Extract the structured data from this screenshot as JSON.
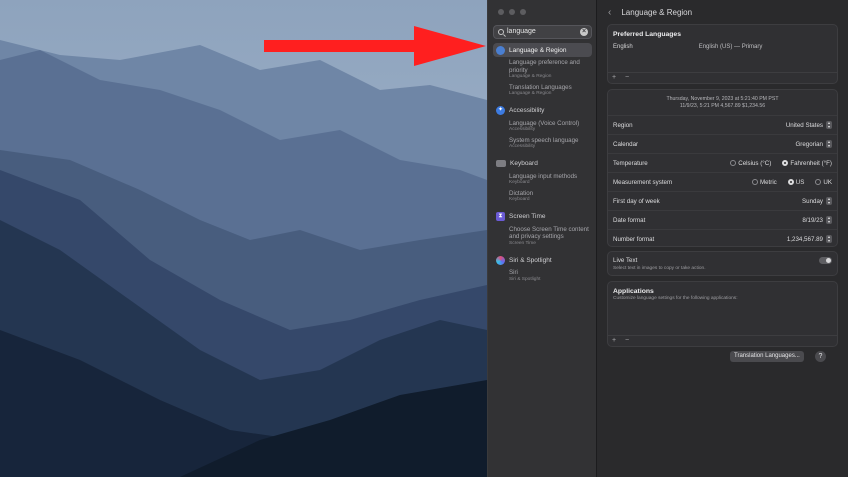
{
  "colors": {
    "accent": "#4a7fd1",
    "annotation_arrow": "#ff1f1f"
  },
  "search": {
    "value": "language"
  },
  "sidebar": {
    "groups": [
      {
        "label": "Language & Region",
        "icon": "globe-icon",
        "selected": true,
        "items": [
          {
            "title": "Language preference and priority",
            "subtitle": "Language & Region"
          },
          {
            "title": "Translation Languages",
            "subtitle": "Language & Region"
          }
        ]
      },
      {
        "label": "Accessibility",
        "icon": "accessibility-icon",
        "items": [
          {
            "title": "Language (Voice Control)",
            "subtitle": "Accessibility"
          },
          {
            "title": "System speech language",
            "subtitle": "Accessibility"
          }
        ]
      },
      {
        "label": "Keyboard",
        "icon": "keyboard-icon",
        "items": [
          {
            "title": "Language input methods",
            "subtitle": "Keyboard"
          },
          {
            "title": "Dictation",
            "subtitle": "Keyboard"
          }
        ]
      },
      {
        "label": "Screen Time",
        "icon": "hourglass-icon",
        "items": [
          {
            "title": "Choose Screen Time content and privacy settings",
            "subtitle": "Screen Time"
          }
        ]
      },
      {
        "label": "Siri & Spotlight",
        "icon": "siri-icon",
        "items": [
          {
            "title": "Siri",
            "subtitle": "Siri & Spotlight"
          }
        ]
      }
    ]
  },
  "main": {
    "title": "Language & Region",
    "preferred": {
      "title": "Preferred Languages",
      "language": "English",
      "language_detail": "English (US) — Primary",
      "add": "+",
      "remove": "−"
    },
    "preview": {
      "line1": "Thursday, November 9, 2023 at 5:21:40 PM PST",
      "line2": "11/9/23, 5:21 PM     4,567.89     $1,234.56"
    },
    "rows": {
      "region": {
        "label": "Region",
        "value": "United States"
      },
      "calendar": {
        "label": "Calendar",
        "value": "Gregorian"
      },
      "temperature": {
        "label": "Temperature",
        "opt1": "Celsius (°C)",
        "opt2": "Fahrenheit (°F)"
      },
      "measurement": {
        "label": "Measurement system",
        "opt1": "Metric",
        "opt2": "US",
        "opt3": "UK"
      },
      "first_day": {
        "label": "First day of week",
        "value": "Sunday"
      },
      "date_format": {
        "label": "Date format",
        "value": "8/19/23"
      },
      "number_format": {
        "label": "Number format",
        "value": "1,234,567.89"
      }
    },
    "live_text": {
      "label": "Live Text",
      "desc": "Select text in images to copy or take action."
    },
    "applications": {
      "title": "Applications",
      "desc": "Customize language settings for the following applications:",
      "add": "+",
      "remove": "−"
    },
    "translation_button": "Translation Languages...",
    "help": "?"
  }
}
